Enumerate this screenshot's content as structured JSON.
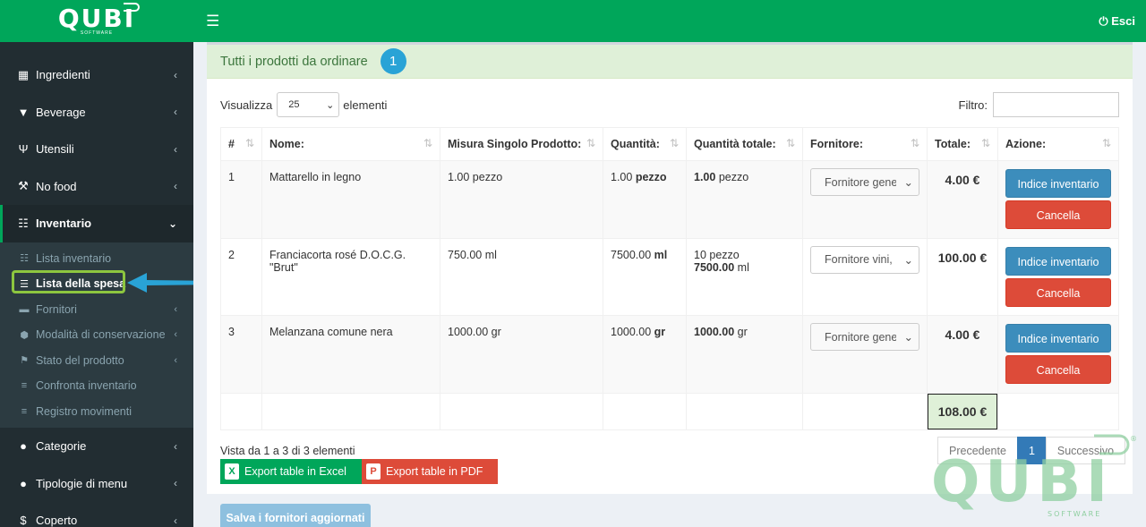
{
  "brand": {
    "name": "QUBI",
    "sub": "SOFTWARE"
  },
  "header": {
    "menu_icon": "bars-icon",
    "logout_label": "Esci"
  },
  "sidebar": {
    "items": [
      {
        "label": "Ingredienti",
        "icon": "cubes-icon"
      },
      {
        "label": "Beverage",
        "icon": "filter-icon"
      },
      {
        "label": "Utensili",
        "icon": "utensils-icon"
      },
      {
        "label": "No food",
        "icon": "wrench-icon"
      },
      {
        "label": "Inventario",
        "icon": "table-icon"
      }
    ],
    "inventario_sub": [
      {
        "label": "Lista inventario",
        "icon": "table-icon"
      },
      {
        "label": "Lista della spesa",
        "icon": "list-icon"
      },
      {
        "label": "Fornitori",
        "icon": "truck-icon"
      },
      {
        "label": "Modalità di conservazione",
        "icon": "cube-icon"
      },
      {
        "label": "Stato del prodotto",
        "icon": "flag-icon"
      },
      {
        "label": "Confronta inventario",
        "icon": "bars-icon"
      },
      {
        "label": "Registro movimenti",
        "icon": "bars-icon"
      }
    ],
    "bottom_items": [
      {
        "label": "Categorie",
        "icon": "info-icon"
      },
      {
        "label": "Tipologie di menu",
        "icon": "info-icon"
      },
      {
        "label": "Coperto",
        "icon": "dollar-icon"
      }
    ]
  },
  "panel": {
    "title": "Tutti i prodotti da ordinare",
    "badge": "1"
  },
  "controls": {
    "show_label": "Visualizza",
    "show_value": "25",
    "show_suffix": "elementi",
    "filter_label": "Filtro:",
    "filter_value": ""
  },
  "table": {
    "headers": [
      "#",
      "Nome:",
      "Misura Singolo Prodotto:",
      "Quantità:",
      "Quantità totale:",
      "Fornitore:",
      "Totale:",
      "Azione:"
    ],
    "rows": [
      {
        "num": "1",
        "name": "Mattarello in legno",
        "measure": "1.00 pezzo",
        "qty_num": "1.00",
        "qty_unit": "pezzo",
        "tot_line1_num": "1.00",
        "tot_line1_unit": "pezzo",
        "tot_line2_num": "",
        "tot_line2_unit": "",
        "supplier": "Fornitore generico",
        "total": "4.00 €"
      },
      {
        "num": "2",
        "name": "Franciacorta rosé D.O.C.G. \"Brut\"",
        "measure": "750.00 ml",
        "qty_num": "7500.00",
        "qty_unit": "ml",
        "tot_line1_num": "10",
        "tot_line1_unit": "pezzo",
        "tot_line2_num": "7500.00",
        "tot_line2_unit": "ml",
        "supplier": "Fornitore vini, ...",
        "total": "100.00 €"
      },
      {
        "num": "3",
        "name": "Melanzana comune nera",
        "measure": "1000.00 gr",
        "qty_num": "1000.00",
        "qty_unit": "gr",
        "tot_line1_num": "1000.00",
        "tot_line1_unit": "gr",
        "tot_line2_num": "",
        "tot_line2_unit": "",
        "supplier": "Fornitore generico",
        "total": "4.00 €"
      }
    ],
    "grand_total": "108.00 €",
    "btn_inventory": "Indice inventario",
    "btn_delete": "Cancella"
  },
  "footer": {
    "info": "Vista da 1 a 3 di 3 elementi",
    "export_excel": "Export table in Excel",
    "export_pdf": "Export table in PDF",
    "prev": "Precedente",
    "page": "1",
    "next": "Successivo",
    "save": "Salva i fornitori aggiornati"
  },
  "colors": {
    "brand_green": "#00a65a",
    "sidebar": "#222d32",
    "primary_blue": "#3c8dbc",
    "danger_red": "#dd4b39",
    "highlight_green": "#8dc63f",
    "callout_blue": "#29a3d6"
  }
}
